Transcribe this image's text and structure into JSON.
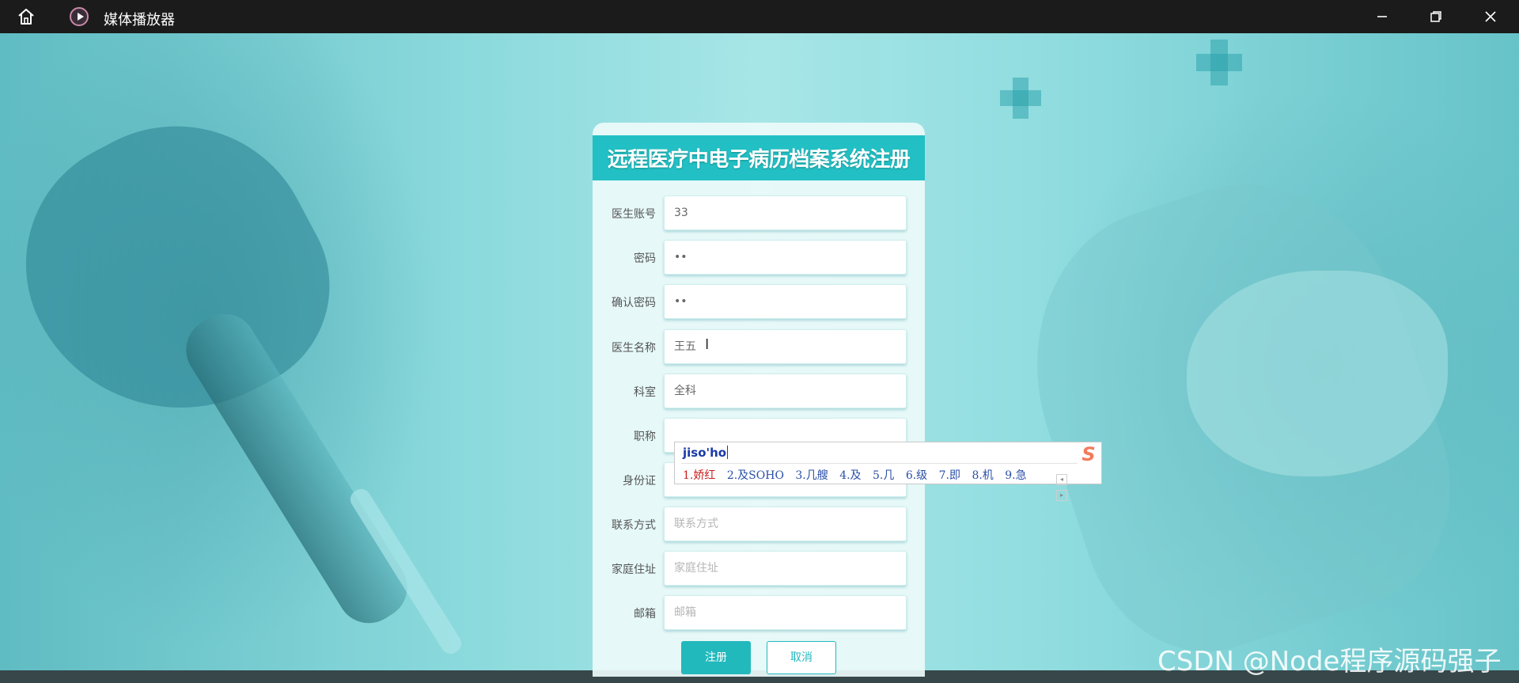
{
  "window": {
    "app_title": "媒体播放器",
    "icons": {
      "home": "home-icon",
      "app": "play-circle-icon",
      "minimize": "minimize-icon",
      "maximize": "restore-icon",
      "close": "close-icon"
    }
  },
  "form": {
    "title": "远程医疗中电子病历档案系统注册",
    "fields": [
      {
        "label": "医生账号",
        "value": "33",
        "placeholder": ""
      },
      {
        "label": "密码",
        "value": "••",
        "placeholder": ""
      },
      {
        "label": "确认密码",
        "value": "••",
        "placeholder": ""
      },
      {
        "label": "医生名称",
        "value": "王五",
        "placeholder": ""
      },
      {
        "label": "科室",
        "value": "全科",
        "placeholder": ""
      },
      {
        "label": "职称",
        "value": "",
        "placeholder": ""
      },
      {
        "label": "身份证",
        "value": "",
        "placeholder": ""
      },
      {
        "label": "联系方式",
        "value": "",
        "placeholder": "联系方式"
      },
      {
        "label": "家庭住址",
        "value": "",
        "placeholder": "家庭住址"
      },
      {
        "label": "邮箱",
        "value": "",
        "placeholder": "邮箱"
      }
    ],
    "register_label": "注册",
    "cancel_label": "取消"
  },
  "ime": {
    "composition": "jiso'ho",
    "candidates": [
      "1.娇红",
      "2.及SOHO",
      "3.几艘",
      "4.及",
      "5.几",
      "6.级",
      "7.即",
      "8.机",
      "9.急"
    ],
    "logo": "S"
  },
  "watermark": "CSDN @Node程序源码强子",
  "colors": {
    "accent": "#22c0c4",
    "titlebar": "#1b1b1b",
    "ime_candidate_first": "#c81e1e",
    "ime_candidate": "#2a4fa8"
  }
}
